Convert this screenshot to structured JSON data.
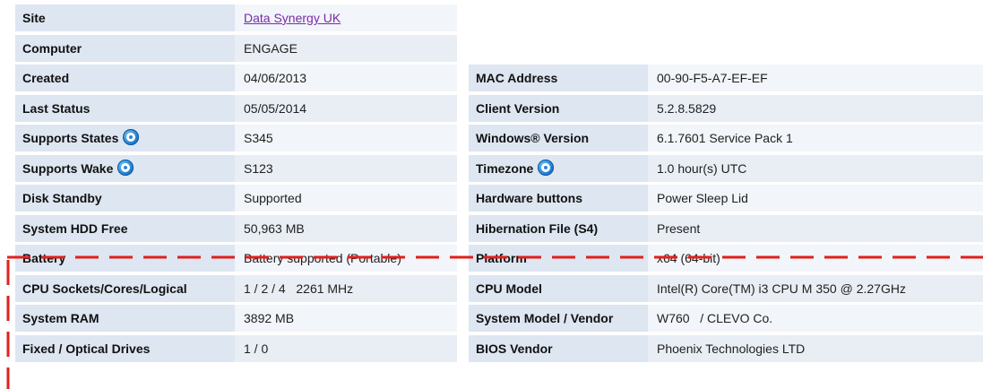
{
  "left_rows": [
    {
      "label": "Site",
      "value": "Data Synergy UK",
      "link": true
    },
    {
      "label": "Computer",
      "value": "ENGAGE"
    },
    {
      "label": "Created",
      "value": "04/06/2013"
    },
    {
      "label": "Last Status",
      "value": "05/05/2014"
    },
    {
      "label": "Supports States",
      "value": "S345",
      "help": true
    },
    {
      "label": "Supports Wake",
      "value": "S123",
      "help": true
    },
    {
      "label": "Disk Standby",
      "value": "Supported"
    },
    {
      "label": "System HDD Free",
      "value": "50,963 MB"
    },
    {
      "label": "Battery",
      "value": "Battery supported (Portable)"
    },
    {
      "label": "CPU Sockets/Cores/Logical",
      "value": "1 / 2 / 4   2261 MHz"
    },
    {
      "label": "System RAM",
      "value": "3892 MB"
    },
    {
      "label": "Fixed / Optical Drives",
      "value": "1 / 0"
    }
  ],
  "right_rows": [
    {
      "label": "MAC Address",
      "value": "00-90-F5-A7-EF-EF"
    },
    {
      "label": "Client Version",
      "value": "5.2.8.5829"
    },
    {
      "label": "Windows® Version",
      "value": "6.1.7601 Service Pack 1"
    },
    {
      "label": "Timezone",
      "value": "1.0 hour(s) UTC",
      "help": true
    },
    {
      "label": "Hardware buttons",
      "value": "Power Sleep Lid"
    },
    {
      "label": "Hibernation File (S4)",
      "value": "Present"
    },
    {
      "label": "Platform",
      "value": "x64 (64-bit)"
    },
    {
      "label": "CPU Model",
      "value": "Intel(R) Core(TM) i3 CPU M 350 @ 2.27GHz"
    },
    {
      "label": "System Model / Vendor",
      "value": "W760   / CLEVO Co."
    },
    {
      "label": "BIOS Vendor",
      "value": "Phoenix Technologies LTD"
    }
  ],
  "colors": {
    "label_bg": "#dde6f1",
    "value_bg": "#f2f5f9",
    "link": "#7b2aa8",
    "annotation_dash": "#e0201c",
    "help_icon": "#1a74c9"
  },
  "icons": {
    "help": "help-question-icon"
  }
}
